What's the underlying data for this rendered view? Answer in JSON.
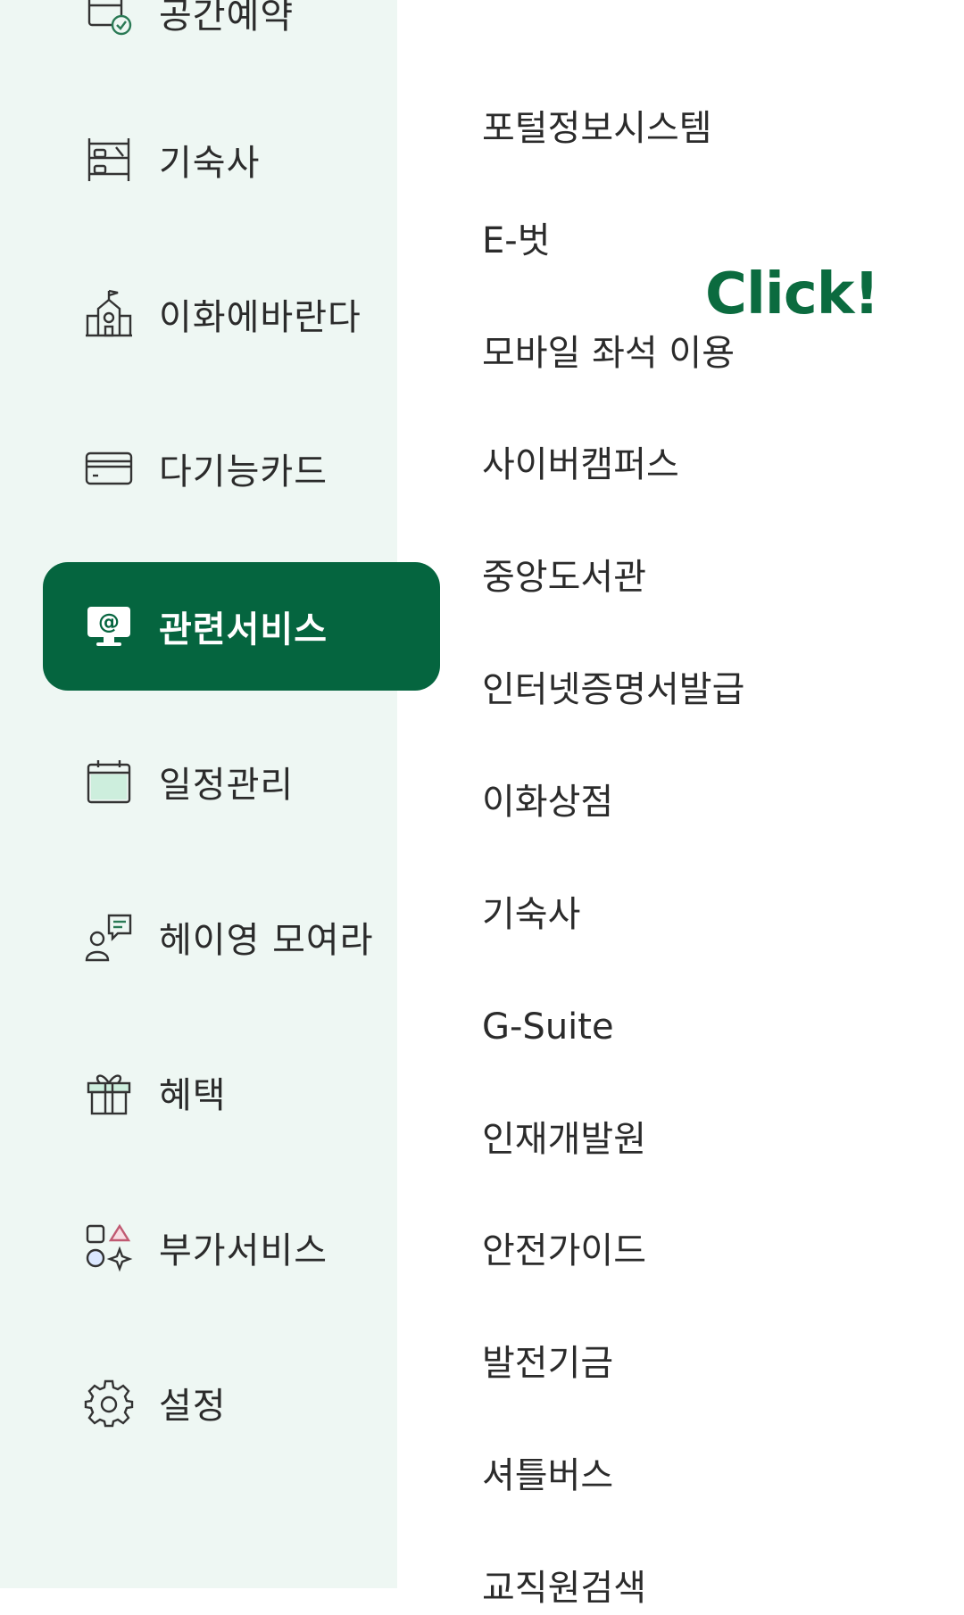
{
  "sidebar": {
    "items": [
      {
        "label": "공간예약",
        "icon": "calendar-check-icon"
      },
      {
        "label": "기숙사",
        "icon": "bunk-bed-icon"
      },
      {
        "label": "이화에바란다",
        "icon": "school-building-icon"
      },
      {
        "label": "다기능카드",
        "icon": "credit-card-icon"
      },
      {
        "label": "관련서비스",
        "icon": "monitor-at-icon",
        "active": true
      },
      {
        "label": "일정관리",
        "icon": "calendar-icon"
      },
      {
        "label": "헤이영 모여라",
        "icon": "person-chat-icon"
      },
      {
        "label": "혜택",
        "icon": "gift-icon"
      },
      {
        "label": "부가서비스",
        "icon": "shapes-sparkle-icon"
      },
      {
        "label": "설정",
        "icon": "gear-icon"
      }
    ]
  },
  "services": [
    "포털정보시스템",
    "E-벗",
    "모바일 좌석 이용",
    "사이버캠퍼스",
    "중앙도서관",
    "인터넷증명서발급",
    "이화상점",
    "기숙사",
    "G-Suite",
    "인재개발원",
    "안전가이드",
    "발전기금",
    "셔틀버스",
    "교직원검색"
  ],
  "annotation": {
    "click_label": "Click!"
  },
  "colors": {
    "sidebar_bg": "#eef7f3",
    "active_bg": "#05653f",
    "click_text": "#0b6b3f"
  }
}
